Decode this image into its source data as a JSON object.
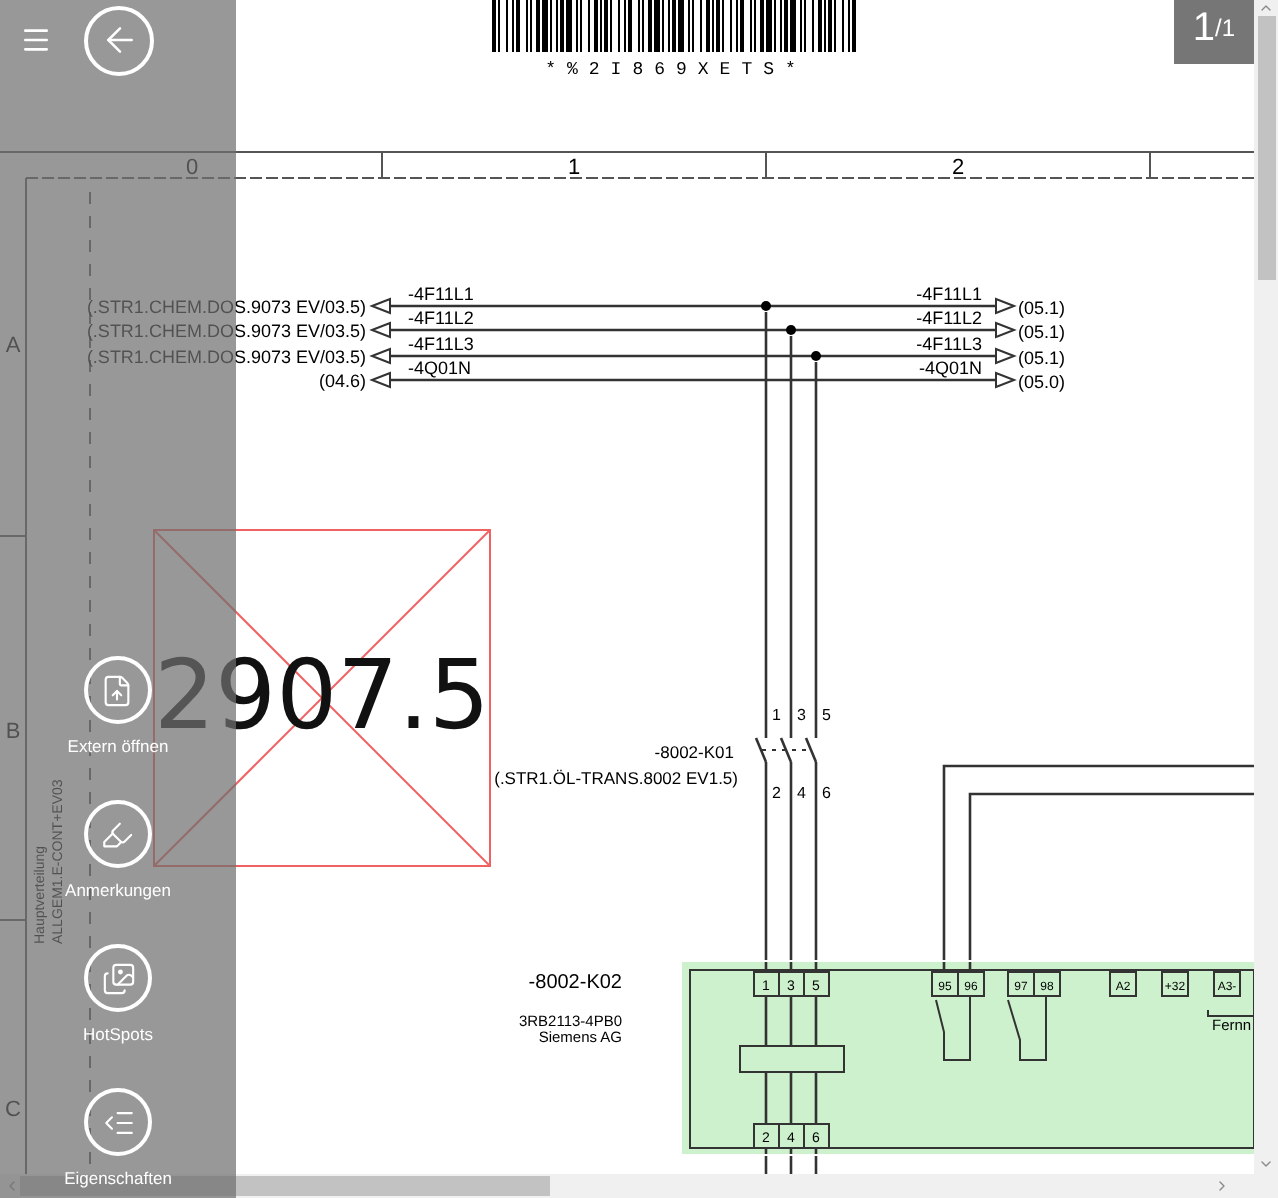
{
  "sidebar": {
    "items": [
      {
        "label": "Extern öffnen",
        "kind": "open"
      },
      {
        "label": "Anmerkungen",
        "kind": "notes"
      },
      {
        "label": "HotSpots",
        "kind": "hotspots"
      },
      {
        "label": "Eigenschaften",
        "kind": "properties"
      }
    ]
  },
  "page_indicator": {
    "current": "1",
    "total": "/1"
  },
  "drawing": {
    "barcode_text": "*%2I869XETS*",
    "columns": [
      "0",
      "1",
      "2"
    ],
    "rows": [
      "A",
      "B",
      "C"
    ],
    "frame_labels": [
      "Hauptverteilung",
      "ALLGEM1.E-CONT+EV03"
    ],
    "signals": [
      {
        "source": "(.STR1.CHEM.DOS.9073 EV/03.5)",
        "wire_left": "-4F11L1",
        "wire_right": "-4F11L1",
        "target": "(05.1)",
        "junction": true
      },
      {
        "source": "(.STR1.CHEM.DOS.9073 EV/03.5)",
        "wire_left": "-4F11L2",
        "wire_right": "-4F11L2",
        "target": "(05.1)",
        "junction": true
      },
      {
        "source": "(.STR1.CHEM.DOS.9073 EV/03.5)",
        "wire_left": "-4F11L3",
        "wire_right": "-4F11L3",
        "target": "(05.1)",
        "junction": true
      },
      {
        "source": "(04.6)",
        "wire_left": "-4Q01N",
        "wire_right": "-4Q01N",
        "target": "(05.0)",
        "junction": false
      }
    ],
    "missing_symbol_value": "2907.5",
    "contactor": {
      "name": "-8002-K01",
      "reference": "(.STR1.ÖL-TRANS.8002 EV1.5)",
      "top_pins": [
        "1",
        "3",
        "5"
      ],
      "bottom_pins": [
        "2",
        "4",
        "6"
      ]
    },
    "relay": {
      "name": "-8002-K02",
      "type": "3RB2113-4PB0",
      "maker": "Siemens AG",
      "top_pins": [
        "1",
        "3",
        "5"
      ],
      "bottom_pins": [
        "2",
        "4",
        "6"
      ],
      "aux_pins": [
        "95",
        "96",
        "97",
        "98",
        "A2",
        "+32",
        "A3-"
      ],
      "note": "Fernn"
    }
  }
}
